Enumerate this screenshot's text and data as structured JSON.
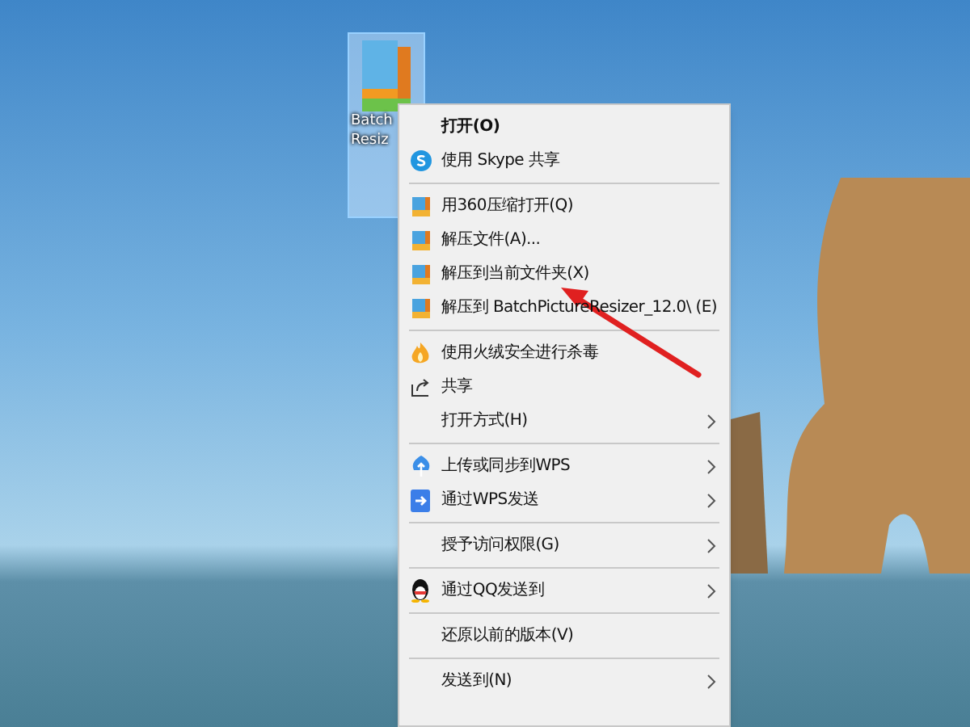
{
  "desktop_icon": {
    "label_lines": [
      "Batch",
      "Resiz"
    ],
    "selected": true
  },
  "context_menu": {
    "items": [
      {
        "kind": "item",
        "label": "打开(O)",
        "bold": true,
        "submenu": false
      },
      {
        "kind": "item",
        "label": "使用 Skype 共享",
        "bold": false,
        "submenu": false
      },
      {
        "kind": "separator"
      },
      {
        "kind": "item",
        "label": "用360压缩打开(Q)",
        "bold": false,
        "submenu": false
      },
      {
        "kind": "item",
        "label": "解压文件(A)...",
        "bold": false,
        "submenu": false
      },
      {
        "kind": "item",
        "label": "解压到当前文件夹(X)",
        "bold": false,
        "submenu": false
      },
      {
        "kind": "item",
        "label": "解压到 BatchPictureResizer_12.0\\ (E)",
        "bold": false,
        "submenu": false
      },
      {
        "kind": "separator"
      },
      {
        "kind": "item",
        "label": "使用火绒安全进行杀毒",
        "bold": false,
        "submenu": false
      },
      {
        "kind": "item",
        "label": "共享",
        "bold": false,
        "submenu": false
      },
      {
        "kind": "item",
        "label": "打开方式(H)",
        "bold": false,
        "submenu": true
      },
      {
        "kind": "separator"
      },
      {
        "kind": "item",
        "label": "上传或同步到WPS",
        "bold": false,
        "submenu": true
      },
      {
        "kind": "item",
        "label": "通过WPS发送",
        "bold": false,
        "submenu": true
      },
      {
        "kind": "separator"
      },
      {
        "kind": "item",
        "label": "授予访问权限(G)",
        "bold": false,
        "submenu": true
      },
      {
        "kind": "separator"
      },
      {
        "kind": "item",
        "label": "通过QQ发送到",
        "bold": false,
        "submenu": true
      },
      {
        "kind": "separator"
      },
      {
        "kind": "item",
        "label": "还原以前的版本(V)",
        "bold": false,
        "submenu": false
      },
      {
        "kind": "separator"
      },
      {
        "kind": "item",
        "label": "发送到(N)",
        "bold": false,
        "submenu": true
      }
    ]
  },
  "annotation": {
    "kind": "arrow",
    "color": "#e02020"
  }
}
